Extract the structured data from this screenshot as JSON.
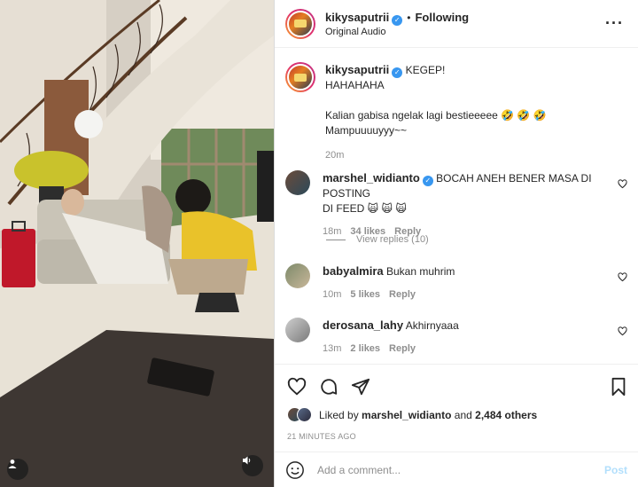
{
  "post": {
    "username": "kikysaputrii",
    "follow_state": "Following",
    "audio": "Original Audio",
    "caption_user": "kikysaputrii",
    "caption_line1": "KEGEP!",
    "caption_line2": "HAHAHAHA",
    "caption_line3": "Kalian gabisa ngelak lagi bestieeeee 🤣 🤣 🤣",
    "caption_line4": "Mampuuuuyyy~~",
    "caption_time": "20m"
  },
  "comments": [
    {
      "username": "marshel_widianto",
      "text_line1": "BOCAH ANEH BENER MASA DI POSTING",
      "text_line2": "DI FEED 🙀 🙀 🙀",
      "time": "18m",
      "likes": "34 likes",
      "reply": "Reply",
      "view_replies": "View replies (10)"
    },
    {
      "username": "babyalmira",
      "text": "Bukan muhrim",
      "time": "10m",
      "likes": "5 likes",
      "reply": "Reply"
    },
    {
      "username": "derosana_lahy",
      "text": "Akhirnyaaa",
      "time": "13m",
      "likes": "2 likes",
      "reply": "Reply"
    }
  ],
  "likes_summary": {
    "prefix": "Liked by",
    "user": "marshel_widianto",
    "middle": "and",
    "others": "2,484 others"
  },
  "posted_ago": "21 MINUTES AGO",
  "add_comment": {
    "placeholder": "Add a comment...",
    "post_label": "Post"
  },
  "icons": {
    "more": "more-icon",
    "verified": "verified-badge-icon",
    "like": "heart-icon",
    "comment": "comment-icon",
    "share": "share-icon",
    "save": "bookmark-icon",
    "emoji": "emoji-icon",
    "sound": "speaker-icon",
    "user": "user-icon"
  },
  "colors": {
    "verified": "#3897f0",
    "post_disabled": "#b2dffc",
    "muted": "#8e8e8e"
  }
}
